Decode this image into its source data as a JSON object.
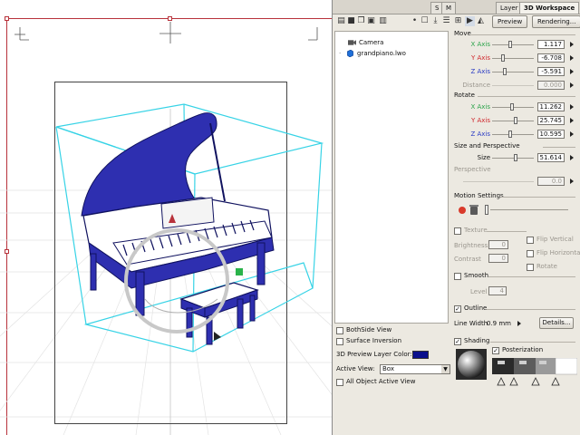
{
  "tabs": [
    "S",
    "M",
    "Layer",
    "3D Workspace"
  ],
  "toolbar": {
    "icons": [
      "folder-icon",
      "save-icon",
      "copy-icon",
      "paste-icon",
      "delete-icon",
      "dot-icon",
      "new-object-icon",
      "download-icon",
      "list-icon",
      "grid-icon",
      "camera-icon",
      "render-icon"
    ],
    "preview_label": "Preview",
    "rendering_label": "Rendering..."
  },
  "tree": {
    "items": [
      {
        "label": "Camera",
        "icon": "camera-icon"
      },
      {
        "label": "grandpiano.lwo",
        "icon": "cube-icon"
      }
    ]
  },
  "lower_left": {
    "bothside_label": "BothSide View",
    "surface_inversion_label": "Surface Inversion",
    "layer_color_label": "3D Preview Layer Color:",
    "layer_color": "#0a0f8c",
    "active_view_label": "Active View:",
    "active_view_value": "Box",
    "all_object_label": "All Object Active View"
  },
  "move": {
    "title": "Move",
    "x_label": "X Axis",
    "x_value": "1.117",
    "y_label": "Y Axis",
    "y_value": "-6.708",
    "z_label": "Z Axis",
    "z_value": "-5.591",
    "distance_label": "Distance",
    "distance_value": "0.000"
  },
  "rotate": {
    "title": "Rotate",
    "x_label": "X Axis",
    "x_value": "11.262",
    "y_label": "Y Axis",
    "y_value": "25.745",
    "z_label": "Z Axis",
    "z_value": "10.595"
  },
  "size_perspective": {
    "title": "Size and Perspective",
    "size_label": "Size",
    "size_value": "51.614",
    "perspective_label": "Perspective",
    "perspective_value": "0.0"
  },
  "motion": {
    "title": "Motion Settings"
  },
  "texture": {
    "label": "Texture",
    "brightness_label": "Brightness",
    "brightness_value": "0",
    "contrast_label": "Contrast",
    "contrast_value": "0",
    "flip_vertical_label": "Flip Vertical",
    "flip_horizontal_label": "Flip Horizontal",
    "rotate_label": "Rotate"
  },
  "smooth": {
    "label": "Smooth",
    "level_label": "Level",
    "level_value": "4"
  },
  "outline": {
    "label": "Outline",
    "line_width_label": "Line Width",
    "line_width_value": "0.9 mm",
    "details_label": "Details..."
  },
  "shading": {
    "label": "Shading",
    "posterization_label": "Posterization"
  },
  "colors": {
    "model_blue": "#2e2fb0",
    "bbox_cyan": "#37d3e6",
    "page_red": "#b8323b",
    "panel_bg": "#ece9e1"
  }
}
